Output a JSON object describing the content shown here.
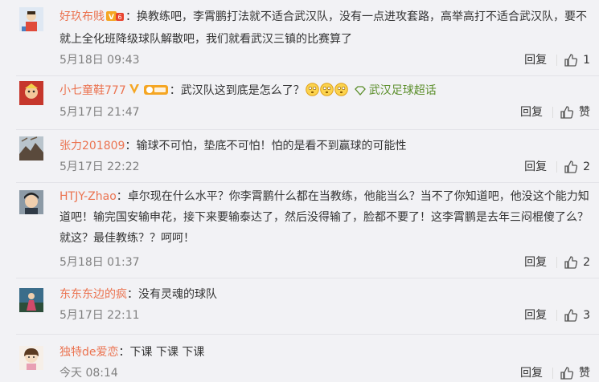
{
  "colors": {
    "username": "#eb7350",
    "text": "#333333",
    "meta": "#808080",
    "topic": "#5b8e2a",
    "background": "#f2f2f5"
  },
  "comments": [
    {
      "user": "好玖布贱",
      "text": "：换教练吧，李霄鹏打法就不适合武汉队，没有一点进攻套路，高举高打不适合武汉队，要不就上全化班降级球队解散吧，我们就看武汉三镇的比赛算了",
      "time": "5月18日 09:43",
      "reply": "回复",
      "likes": "1"
    },
    {
      "user": "小七童鞋777",
      "text": "：武汉队这到底是怎么了？",
      "topic": "武汉足球超话",
      "time": "5月17日 21:47",
      "reply": "回复",
      "likes": "赞"
    },
    {
      "user": "张力201809",
      "text": "：输球不可怕，垫底不可怕！怕的是看不到赢球的可能性",
      "time": "5月17日 22:22",
      "reply": "回复",
      "likes": "2"
    },
    {
      "user": "HTJY-Zhao",
      "text": "：卓尔现在什么水平？你李霄鹏什么都在当教练，他能当么？当不了你知道吧，他没这个能力知道吧！输完国安输申花，接下来要输泰达了，然后没得输了，脸都不要了！这李霄鹏是去年三闷棍傻了么？就这？最佳教练？？呵呵！",
      "time": "5月18日 01:37",
      "reply": "回复",
      "likes": "2"
    },
    {
      "user": "东东东边的疯",
      "text": "：没有灵魂的球队",
      "time": "5月17日 22:11",
      "reply": "回复",
      "likes": "3"
    },
    {
      "user": "独特de爱恋",
      "text": "：下课 下课 下课",
      "time": "今天 08:14",
      "reply": "回复",
      "likes": "赞"
    }
  ]
}
